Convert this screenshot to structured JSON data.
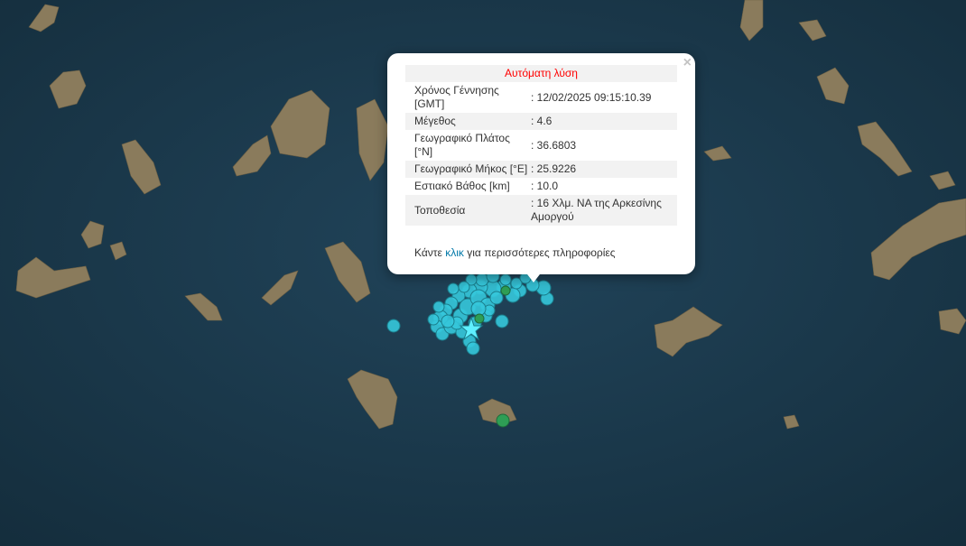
{
  "map": {
    "water_color": "#1c3a4c",
    "island_color": "#8a7b5c",
    "event_color": "#35c8dc",
    "event_outline": "#1b7e8c",
    "older_event_color": "#2e9e55",
    "latest_marker": "star-icon"
  },
  "popup": {
    "title": "Αυτόματη λύση",
    "close_symbol": "×",
    "rows": [
      {
        "label": "Χρόνος Γέννησης [GMT]",
        "value": ": 12/02/2025 09:15:10.39"
      },
      {
        "label": "Μέγεθος",
        "value": ": 4.6"
      },
      {
        "label": "Γεωγραφικό Πλάτος [°N]",
        "value": ": 36.6803"
      },
      {
        "label": "Γεωγραφικό Μήκος [°E]",
        "value": ": 25.9226"
      },
      {
        "label": "Εστιακό Βάθος [km]",
        "value": ": 10.0"
      },
      {
        "label": "Τοποθεσία",
        "value": ": 16 Χλμ. ΝΑ της Αρκεσίνης Αμοργού"
      }
    ],
    "more_prefix": "Κάντε",
    "more_link": "κλικ",
    "more_suffix": "για περισσότερες πληροφορίες"
  }
}
